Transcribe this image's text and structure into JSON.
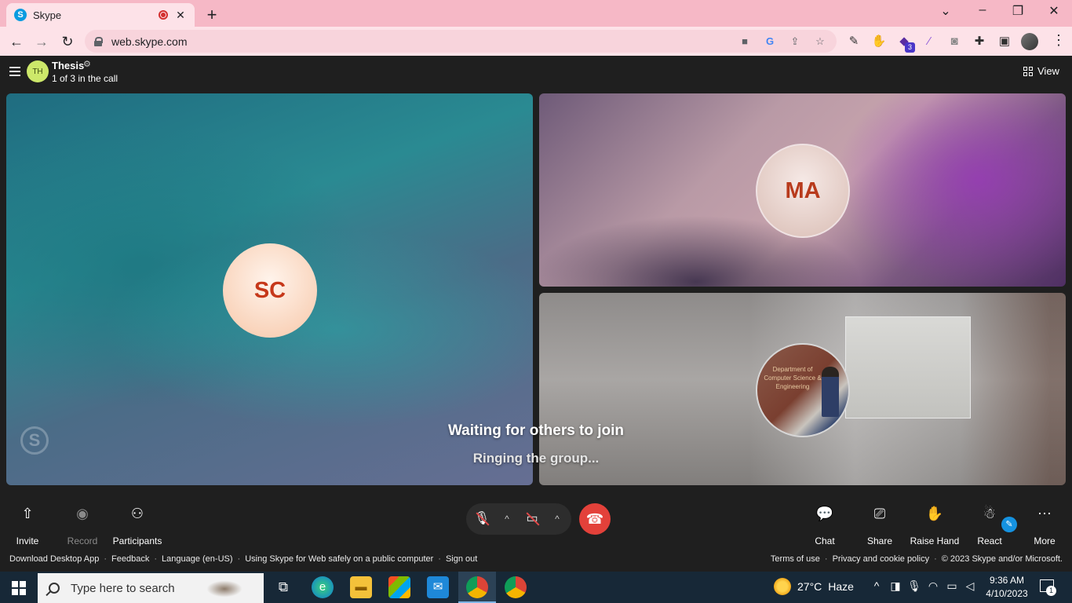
{
  "browser": {
    "tab_title": "Skype",
    "tab_favicon": "S",
    "tab_close": "✕",
    "new_tab": "+",
    "window_controls": {
      "dropdown": "⌄",
      "minimize": "–",
      "restore": "❐",
      "close": "✕"
    },
    "url": "web.skype.com",
    "omnibox_icons": [
      "camera-icon",
      "google-icon",
      "share-icon",
      "star-icon"
    ],
    "extension_icons": [
      "eyedropper-icon",
      "paw-icon",
      "graduation-cap-icon",
      "pen-icon",
      "screenshot-icon",
      "puzzle-icon",
      "sidepanel-icon"
    ],
    "extension_badge": "3"
  },
  "call_header": {
    "group_initials": "TH",
    "group_title": "Thesis",
    "participants_status": "1 of 3 in the call",
    "view_label": "View"
  },
  "tiles": [
    {
      "id": "sc",
      "initials": "SC"
    },
    {
      "id": "ma",
      "initials": "MA"
    },
    {
      "id": "self",
      "photo_text": "Department of Computer Science & Engineering"
    }
  ],
  "watermark": "S",
  "status": {
    "waiting": "Waiting for others to join",
    "ringing": "Ringing the group..."
  },
  "controls": {
    "left": [
      {
        "label": "Invite",
        "icon": "share-up-icon",
        "enabled": true
      },
      {
        "label": "Record",
        "icon": "record-icon",
        "enabled": false
      },
      {
        "label": "Participants",
        "icon": "people-icon",
        "enabled": true
      }
    ],
    "right": [
      {
        "label": "Chat",
        "icon": "chat-icon"
      },
      {
        "label": "Share screen",
        "icon": "share-screen-icon"
      },
      {
        "label": "Raise Hand",
        "icon": "hand-icon"
      },
      {
        "label": "React",
        "icon": "react-icon"
      },
      {
        "label": "More",
        "icon": "more-icon"
      }
    ],
    "mic_state": "muted",
    "camera_state": "off"
  },
  "footer": {
    "left": [
      "Download Desktop App",
      "Feedback",
      "Language (en-US)",
      "Using Skype for Web safely on a public computer",
      "Sign out"
    ],
    "right": [
      "Terms of use",
      "Privacy and cookie policy",
      "© 2023 Skype and/or Microsoft."
    ]
  },
  "taskbar": {
    "search_placeholder": "Type here to search",
    "weather_temp": "27°C",
    "weather_cond": "Haze",
    "time": "9:36 AM",
    "date": "4/10/2023",
    "notification_count": "1"
  },
  "colors": {
    "skype_blue": "#0a9be0",
    "hangup_red": "#e3413a",
    "avatar_text": "#c6381a",
    "chrome_pink": "#f6b8c6"
  }
}
